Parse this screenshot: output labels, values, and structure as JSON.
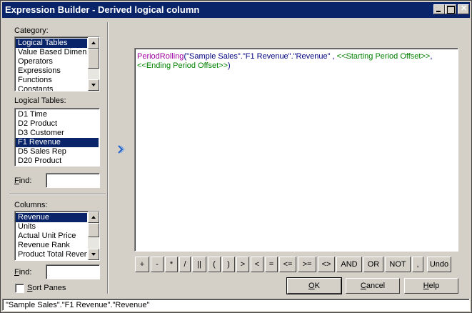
{
  "window": {
    "title": "Expression Builder - Derived logical column"
  },
  "category": {
    "label": "Category:",
    "items": [
      "Logical Tables",
      "Value Based Dimensions",
      "Operators",
      "Expressions",
      "Functions",
      "Constants"
    ],
    "selected_index": 0
  },
  "logical_tables": {
    "label": "Logical Tables:",
    "items": [
      "D1 Time",
      "D2 Product",
      "D3 Customer",
      "F1 Revenue",
      "D5 Sales Rep",
      "D20 Product"
    ],
    "selected_index": 3,
    "find_label": "Find:",
    "find_value": ""
  },
  "columns": {
    "label": "Columns:",
    "items": [
      "Revenue",
      "Units",
      "Actual Unit Price",
      "Revenue Rank",
      "Product Total Revenue"
    ],
    "selected_index": 0,
    "find_label": "Find:",
    "find_value": ""
  },
  "sort_panes": {
    "label": "Sort Panes",
    "checked": false
  },
  "insert_icon": "chevron-right-icon",
  "expression": {
    "fn": "PeriodRolling",
    "open": "(",
    "arg1": "\"Sample Sales\".\"F1 Revenue\".\"Revenue\"",
    "sep1": " , ",
    "arg2": "<<Starting Period Offset>>",
    "sep2": ",",
    "arg3": "<<Ending Period Offset>>",
    "close": ")"
  },
  "operators": [
    "+",
    "-",
    "*",
    "/",
    "||",
    "(",
    ")",
    ">",
    "<",
    "=",
    "<=",
    ">=",
    "<>",
    "AND",
    "OR",
    "NOT",
    ",",
    "Undo"
  ],
  "buttons": {
    "ok": "OK",
    "cancel": "Cancel",
    "help": "Help"
  },
  "status_bar": {
    "text": "\"Sample Sales\".\"F1 Revenue\".\"Revenue\""
  },
  "colors": {
    "title_bar": "#0a246a",
    "function": "#a000a0",
    "string": "#000080",
    "placeholder": "#008000",
    "selection": "#0a246a"
  }
}
